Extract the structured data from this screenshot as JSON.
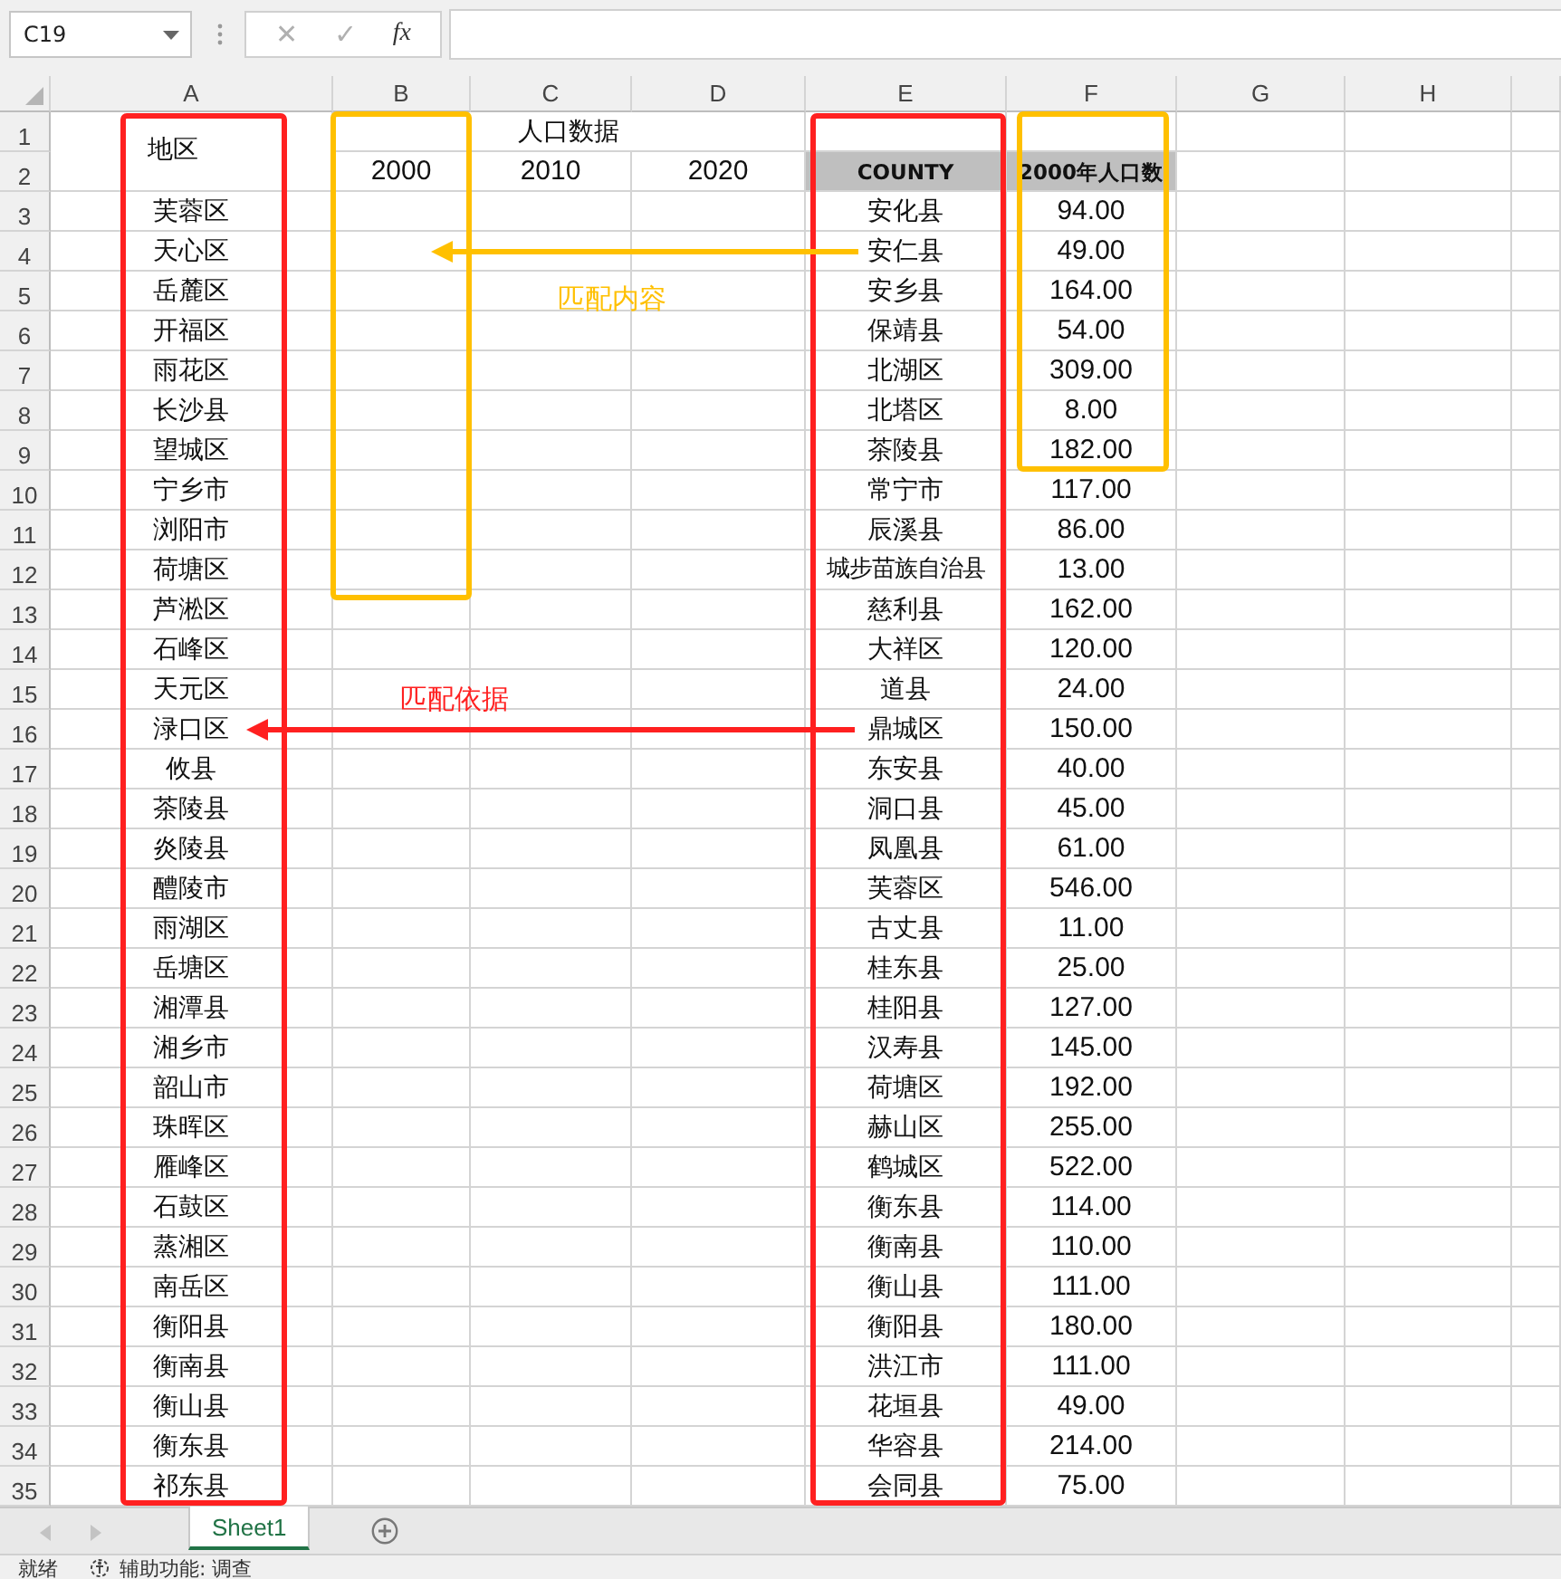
{
  "name_box": {
    "value": "C19"
  },
  "formula_buttons": [
    {
      "label": "✕",
      "disabled": true
    },
    {
      "label": "✓",
      "disabled": true
    },
    {
      "label": "fx",
      "disabled": false
    }
  ],
  "columns": [
    "A",
    "B",
    "C",
    "D",
    "E",
    "F",
    "G",
    "H"
  ],
  "row_numbers": [
    "1",
    "2",
    "3",
    "4",
    "5",
    "6",
    "7",
    "8",
    "9",
    "10",
    "11",
    "12",
    "13",
    "14",
    "15",
    "16",
    "17",
    "18",
    "19",
    "20",
    "21",
    "22",
    "23",
    "24",
    "25",
    "26",
    "27",
    "28",
    "29",
    "30",
    "31",
    "32",
    "33",
    "34",
    "35"
  ],
  "header": {
    "region_title": "地区",
    "group_title": "人口数据",
    "years": [
      "2000",
      "2010",
      "2020"
    ],
    "county_title": "COUNTY",
    "population_title": "2000年人口数"
  },
  "regions": [
    "芙蓉区",
    "天心区",
    "岳麓区",
    "开福区",
    "雨花区",
    "长沙县",
    "望城区",
    "宁乡市",
    "浏阳市",
    "荷塘区",
    "芦淞区",
    "石峰区",
    "天元区",
    "渌口区",
    "攸县",
    "茶陵县",
    "炎陵县",
    "醴陵市",
    "雨湖区",
    "岳塘区",
    "湘潭县",
    "湘乡市",
    "韶山市",
    "珠晖区",
    "雁峰区",
    "石鼓区",
    "蒸湘区",
    "南岳区",
    "衡阳县",
    "衡南县",
    "衡山县",
    "衡东县",
    "祁东县"
  ],
  "counties": [
    {
      "county": "安化县",
      "population": "94.00"
    },
    {
      "county": "安仁县",
      "population": "49.00"
    },
    {
      "county": "安乡县",
      "population": "164.00"
    },
    {
      "county": "保靖县",
      "population": "54.00"
    },
    {
      "county": "北湖区",
      "population": "309.00"
    },
    {
      "county": "北塔区",
      "population": "8.00"
    },
    {
      "county": "茶陵县",
      "population": "182.00"
    },
    {
      "county": "常宁市",
      "population": "117.00"
    },
    {
      "county": "辰溪县",
      "population": "86.00"
    },
    {
      "county": "城步苗族自治县",
      "population": "13.00"
    },
    {
      "county": "慈利县",
      "population": "162.00"
    },
    {
      "county": "大祥区",
      "population": "120.00"
    },
    {
      "county": "道县",
      "population": "24.00"
    },
    {
      "county": "鼎城区",
      "population": "150.00"
    },
    {
      "county": "东安县",
      "population": "40.00"
    },
    {
      "county": "洞口县",
      "population": "45.00"
    },
    {
      "county": "凤凰县",
      "population": "61.00"
    },
    {
      "county": "芙蓉区",
      "population": "546.00"
    },
    {
      "county": "古丈县",
      "population": "11.00"
    },
    {
      "county": "桂东县",
      "population": "25.00"
    },
    {
      "county": "桂阳县",
      "population": "127.00"
    },
    {
      "county": "汉寿县",
      "population": "145.00"
    },
    {
      "county": "荷塘区",
      "population": "192.00"
    },
    {
      "county": "赫山区",
      "population": "255.00"
    },
    {
      "county": "鹤城区",
      "population": "522.00"
    },
    {
      "county": "衡东县",
      "population": "114.00"
    },
    {
      "county": "衡南县",
      "population": "110.00"
    },
    {
      "county": "衡山县",
      "population": "111.00"
    },
    {
      "county": "衡阳县",
      "population": "180.00"
    },
    {
      "county": "洪江市",
      "population": "111.00"
    },
    {
      "county": "花垣县",
      "population": "49.00"
    },
    {
      "county": "华容县",
      "population": "214.00"
    },
    {
      "county": "会同县",
      "population": "75.00"
    }
  ],
  "highlights": [
    {
      "color": "#ff2020"
    },
    {
      "color": "#ff2020"
    },
    {
      "color": "#ffc000"
    },
    {
      "color": "#ffc000"
    }
  ],
  "arrows": [
    {
      "label": "匹配内容",
      "color": "#ffc000"
    },
    {
      "label": "匹配依据",
      "color": "#ff2020"
    }
  ],
  "sheet_tabs": [
    {
      "label": "Sheet1",
      "selected": true
    }
  ],
  "status_bar": {
    "state": "就绪",
    "accessibility": "辅助功能: 调查"
  }
}
